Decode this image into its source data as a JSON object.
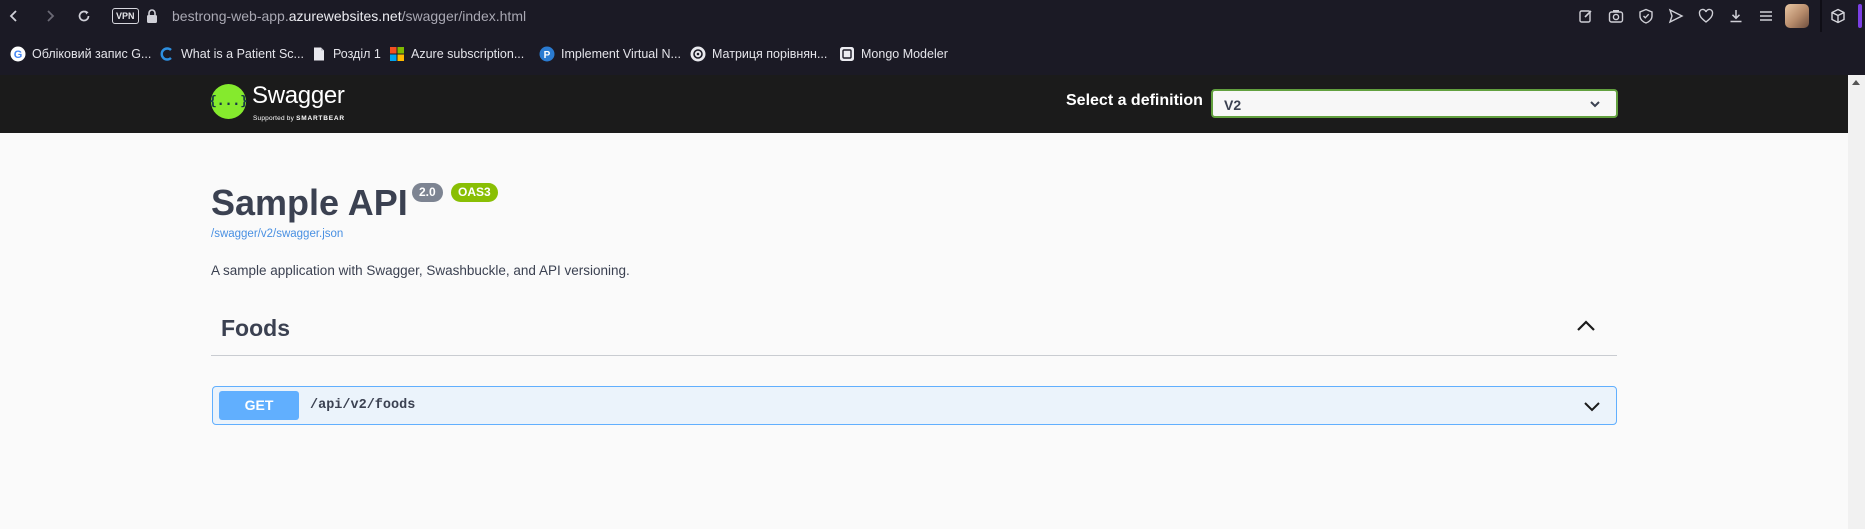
{
  "browser": {
    "vpn_label": "VPN",
    "url_prefix": "bestrong-web-app.",
    "url_host": "azurewebsites.net",
    "url_path": "/swagger/index.html",
    "nav_icons": [
      "back-icon",
      "forward-icon",
      "reload-icon"
    ],
    "right_icons": [
      "edit-icon",
      "camera-icon",
      "shield-icon",
      "send-icon",
      "heart-icon",
      "download-icon",
      "menu-icon"
    ]
  },
  "bookmarks": [
    {
      "label": "Обліковий запис G...",
      "icon": "google-icon"
    },
    {
      "label": "What is a Patient Sc...",
      "icon": "c-icon"
    },
    {
      "label": "Розділ 1",
      "icon": "document-icon"
    },
    {
      "label": "Azure subscription...",
      "icon": "microsoft-icon"
    },
    {
      "label": "Implement Virtual N...",
      "icon": "pearson-icon"
    },
    {
      "label": "Матриця порівнян...",
      "icon": "openai-icon"
    },
    {
      "label": "Mongo Modeler",
      "icon": "mongo-modeler-icon"
    }
  ],
  "swagger": {
    "logo_text": "Swagger",
    "logo_supported": "Supported by",
    "logo_brand": "SMARTBEAR",
    "logo_glyph": "{...}",
    "definition_label": "Select a definition",
    "definition_value": "V2",
    "accent_color": "#85ea2d"
  },
  "info": {
    "title": "Sample API",
    "version": "2.0",
    "oas": "OAS3",
    "spec_url": "/swagger/v2/swagger.json",
    "description": "A sample application with Swagger, Swashbuckle, and API versioning."
  },
  "tags": [
    {
      "name": "Foods",
      "operations": [
        {
          "method": "GET",
          "path": "/api/v2/foods",
          "color": "#61affe"
        }
      ]
    }
  ]
}
